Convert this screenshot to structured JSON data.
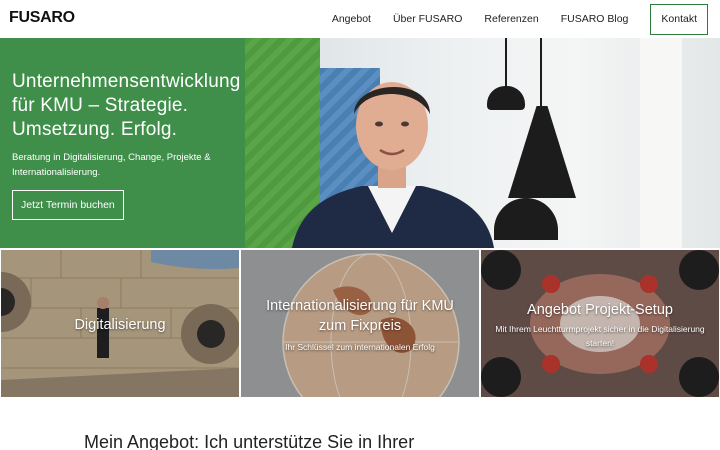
{
  "header": {
    "logo": "FUSARO",
    "nav": [
      "Angebot",
      "Über FUSARO",
      "Referenzen",
      "FUSARO Blog"
    ],
    "cta": "Kontakt"
  },
  "hero": {
    "title_lines": [
      "Unternehmensentwicklung",
      "für KMU – Strategie.",
      "Umsetzung. Erfolg."
    ],
    "subtitle": "Beratung in Digitalisierung, Change, Projekte & Internationalisierung.",
    "button": "Jetzt Termin buchen"
  },
  "tiles": [
    {
      "title": "Digitalisierung",
      "subtitle": ""
    },
    {
      "title": "Internationalisierung für KMU zum Fixpreis",
      "subtitle": "Ihr Schlüssel zum internationalen Erfolg"
    },
    {
      "title": "Angebot Projekt-Setup",
      "subtitle": "Mit Ihrem Leuchtturmprojekt sicher in die Digitalisierung starten!"
    }
  ],
  "section": {
    "heading": "Mein Angebot: Ich unterstütze Sie in Ihrer"
  },
  "colors": {
    "brand_green": "#3f8f4a",
    "cta_border": "#2d7a3a"
  }
}
